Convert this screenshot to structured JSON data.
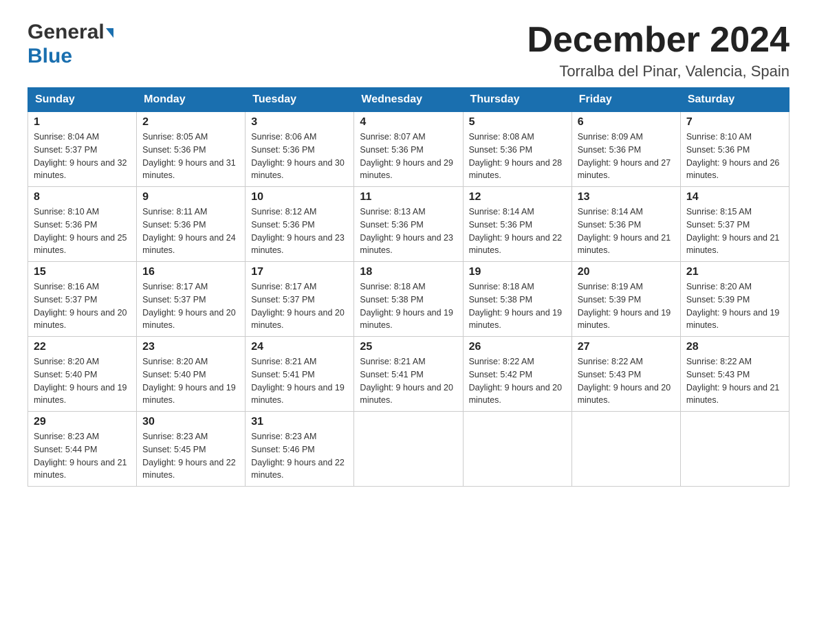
{
  "header": {
    "logo_general": "General",
    "logo_blue": "Blue",
    "month_title": "December 2024",
    "location": "Torralba del Pinar, Valencia, Spain"
  },
  "days_of_week": [
    "Sunday",
    "Monday",
    "Tuesday",
    "Wednesday",
    "Thursday",
    "Friday",
    "Saturday"
  ],
  "weeks": [
    [
      {
        "day": "1",
        "sunrise": "8:04 AM",
        "sunset": "5:37 PM",
        "daylight": "9 hours and 32 minutes."
      },
      {
        "day": "2",
        "sunrise": "8:05 AM",
        "sunset": "5:36 PM",
        "daylight": "9 hours and 31 minutes."
      },
      {
        "day": "3",
        "sunrise": "8:06 AM",
        "sunset": "5:36 PM",
        "daylight": "9 hours and 30 minutes."
      },
      {
        "day": "4",
        "sunrise": "8:07 AM",
        "sunset": "5:36 PM",
        "daylight": "9 hours and 29 minutes."
      },
      {
        "day": "5",
        "sunrise": "8:08 AM",
        "sunset": "5:36 PM",
        "daylight": "9 hours and 28 minutes."
      },
      {
        "day": "6",
        "sunrise": "8:09 AM",
        "sunset": "5:36 PM",
        "daylight": "9 hours and 27 minutes."
      },
      {
        "day": "7",
        "sunrise": "8:10 AM",
        "sunset": "5:36 PM",
        "daylight": "9 hours and 26 minutes."
      }
    ],
    [
      {
        "day": "8",
        "sunrise": "8:10 AM",
        "sunset": "5:36 PM",
        "daylight": "9 hours and 25 minutes."
      },
      {
        "day": "9",
        "sunrise": "8:11 AM",
        "sunset": "5:36 PM",
        "daylight": "9 hours and 24 minutes."
      },
      {
        "day": "10",
        "sunrise": "8:12 AM",
        "sunset": "5:36 PM",
        "daylight": "9 hours and 23 minutes."
      },
      {
        "day": "11",
        "sunrise": "8:13 AM",
        "sunset": "5:36 PM",
        "daylight": "9 hours and 23 minutes."
      },
      {
        "day": "12",
        "sunrise": "8:14 AM",
        "sunset": "5:36 PM",
        "daylight": "9 hours and 22 minutes."
      },
      {
        "day": "13",
        "sunrise": "8:14 AM",
        "sunset": "5:36 PM",
        "daylight": "9 hours and 21 minutes."
      },
      {
        "day": "14",
        "sunrise": "8:15 AM",
        "sunset": "5:37 PM",
        "daylight": "9 hours and 21 minutes."
      }
    ],
    [
      {
        "day": "15",
        "sunrise": "8:16 AM",
        "sunset": "5:37 PM",
        "daylight": "9 hours and 20 minutes."
      },
      {
        "day": "16",
        "sunrise": "8:17 AM",
        "sunset": "5:37 PM",
        "daylight": "9 hours and 20 minutes."
      },
      {
        "day": "17",
        "sunrise": "8:17 AM",
        "sunset": "5:37 PM",
        "daylight": "9 hours and 20 minutes."
      },
      {
        "day": "18",
        "sunrise": "8:18 AM",
        "sunset": "5:38 PM",
        "daylight": "9 hours and 19 minutes."
      },
      {
        "day": "19",
        "sunrise": "8:18 AM",
        "sunset": "5:38 PM",
        "daylight": "9 hours and 19 minutes."
      },
      {
        "day": "20",
        "sunrise": "8:19 AM",
        "sunset": "5:39 PM",
        "daylight": "9 hours and 19 minutes."
      },
      {
        "day": "21",
        "sunrise": "8:20 AM",
        "sunset": "5:39 PM",
        "daylight": "9 hours and 19 minutes."
      }
    ],
    [
      {
        "day": "22",
        "sunrise": "8:20 AM",
        "sunset": "5:40 PM",
        "daylight": "9 hours and 19 minutes."
      },
      {
        "day": "23",
        "sunrise": "8:20 AM",
        "sunset": "5:40 PM",
        "daylight": "9 hours and 19 minutes."
      },
      {
        "day": "24",
        "sunrise": "8:21 AM",
        "sunset": "5:41 PM",
        "daylight": "9 hours and 19 minutes."
      },
      {
        "day": "25",
        "sunrise": "8:21 AM",
        "sunset": "5:41 PM",
        "daylight": "9 hours and 20 minutes."
      },
      {
        "day": "26",
        "sunrise": "8:22 AM",
        "sunset": "5:42 PM",
        "daylight": "9 hours and 20 minutes."
      },
      {
        "day": "27",
        "sunrise": "8:22 AM",
        "sunset": "5:43 PM",
        "daylight": "9 hours and 20 minutes."
      },
      {
        "day": "28",
        "sunrise": "8:22 AM",
        "sunset": "5:43 PM",
        "daylight": "9 hours and 21 minutes."
      }
    ],
    [
      {
        "day": "29",
        "sunrise": "8:23 AM",
        "sunset": "5:44 PM",
        "daylight": "9 hours and 21 minutes."
      },
      {
        "day": "30",
        "sunrise": "8:23 AM",
        "sunset": "5:45 PM",
        "daylight": "9 hours and 22 minutes."
      },
      {
        "day": "31",
        "sunrise": "8:23 AM",
        "sunset": "5:46 PM",
        "daylight": "9 hours and 22 minutes."
      },
      null,
      null,
      null,
      null
    ]
  ],
  "labels": {
    "sunrise": "Sunrise:",
    "sunset": "Sunset:",
    "daylight": "Daylight:"
  }
}
